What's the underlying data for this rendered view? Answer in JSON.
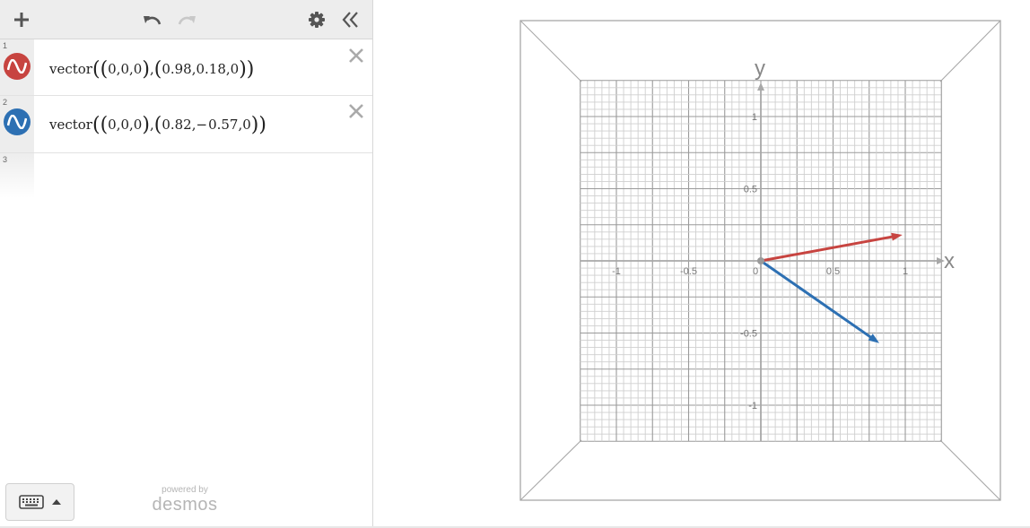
{
  "toolbar": {
    "add_icon": "plus-icon",
    "undo_icon": "undo-icon",
    "redo_icon": "redo-icon",
    "settings_icon": "gear-icon",
    "collapse_icon": "double-chevron-left-icon"
  },
  "expressions": [
    {
      "index": "1",
      "color": "#c74440",
      "fn": "vector",
      "p1": "0,0,0",
      "p2": "0.98,0.18,0",
      "from": [
        0,
        0,
        0
      ],
      "to": [
        0.98,
        0.18,
        0
      ]
    },
    {
      "index": "2",
      "color": "#2d70b3",
      "fn": "vector",
      "p1": "0,0,0",
      "p2_x": "0.82,",
      "p2_sign": "−",
      "p2_rest": "0.57,0",
      "from": [
        0,
        0,
        0
      ],
      "to": [
        0.82,
        -0.57,
        0
      ]
    },
    {
      "index": "3"
    }
  ],
  "branding": {
    "powered_by": "powered by",
    "name": "desmos"
  },
  "graph": {
    "x_axis_label": "x",
    "y_axis_label": "y",
    "x_ticks": [
      "-1",
      "-0.5",
      "0",
      "0.5",
      "1"
    ],
    "y_ticks": [
      "1",
      "0.5",
      "-0.5",
      "-1"
    ],
    "range": [
      -1.25,
      1.25
    ],
    "grid_color": "#cfcfcf",
    "major_grid_color": "#9a9a9a",
    "axis_color": "#a8a8a8"
  }
}
